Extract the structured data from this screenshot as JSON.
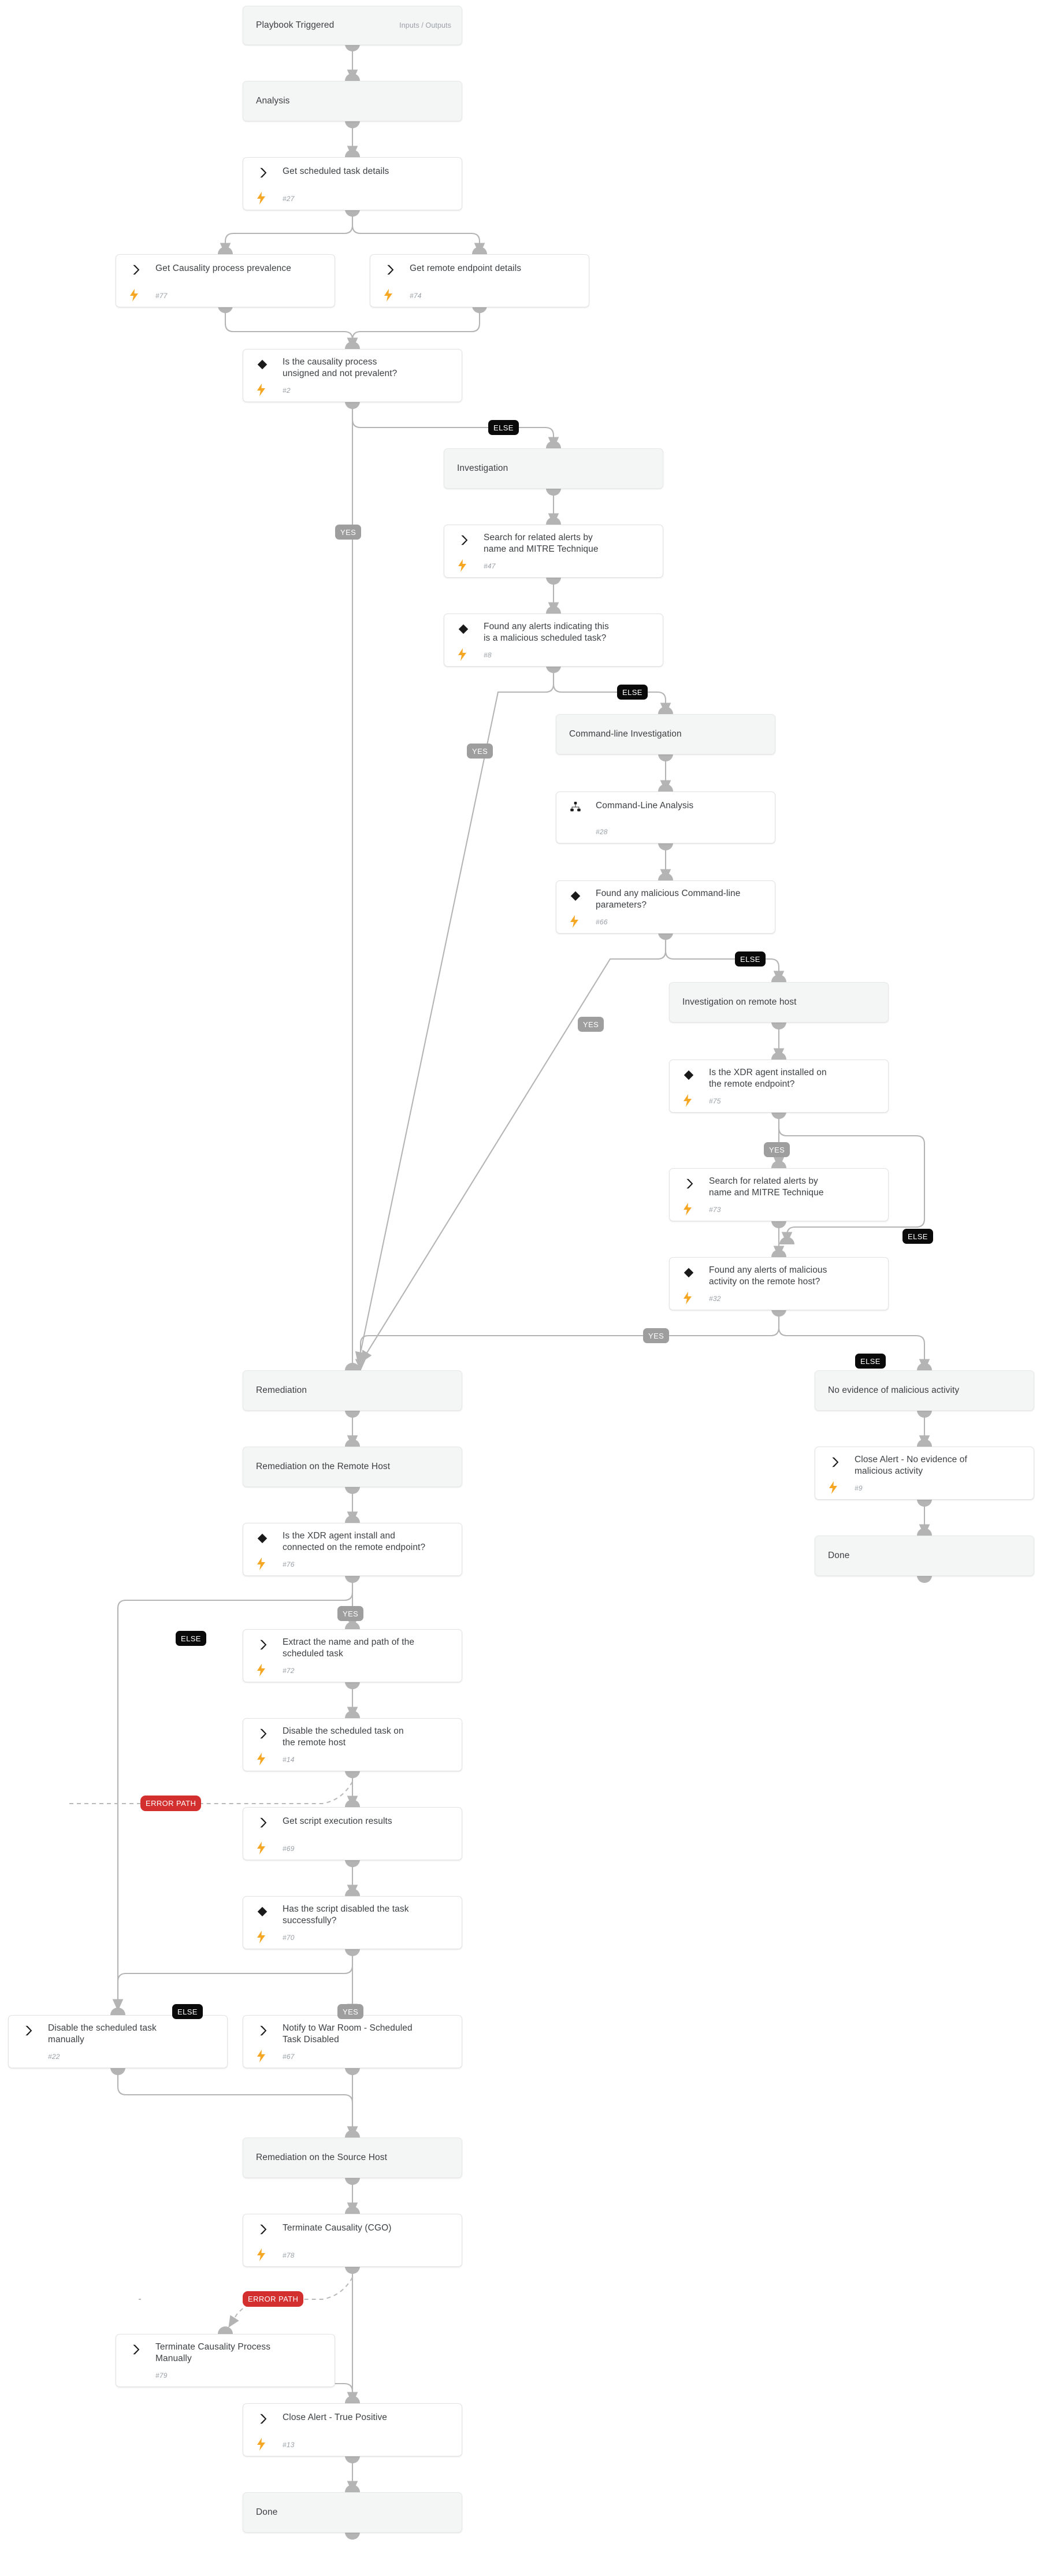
{
  "diagram": {
    "kind": "playbook-flowchart",
    "colors": {
      "wire": "#b4b4b4",
      "card_bg": "#ffffff",
      "section_bg": "#f4f6f5",
      "border": "#e2e2e2",
      "text": "#3c4043",
      "muted": "#9aa0a6",
      "bolt": "#f5a623",
      "yes_pill": "#9e9e9e",
      "else_pill": "#0a0a0a",
      "error_pill": "#d32f2f"
    },
    "icons": {
      "task": "chevron-right-icon",
      "conditional": "diamond-icon",
      "subplaybook": "sitemap-icon",
      "automation": "lightning-bolt-icon"
    }
  },
  "nodes": [
    {
      "id": "start",
      "type": "section",
      "title": "Playbook Triggered",
      "meta": "Inputs / Outputs"
    },
    {
      "id": "analysis",
      "type": "section",
      "title": "Analysis"
    },
    {
      "id": "t27",
      "type": "task",
      "title": "Get scheduled task details",
      "task_id": "#27",
      "automated": true
    },
    {
      "id": "t77",
      "type": "task",
      "title": "Get Causality process prevalence",
      "task_id": "#77",
      "automated": true
    },
    {
      "id": "t74",
      "type": "task",
      "title": "Get remote endpoint details",
      "task_id": "#74",
      "automated": true
    },
    {
      "id": "c2",
      "type": "conditional",
      "title": "Is the causality process\nunsigned and not prevalent?",
      "task_id": "#2",
      "automated": true
    },
    {
      "id": "sec_inv",
      "type": "section",
      "title": "Investigation"
    },
    {
      "id": "t47",
      "type": "task",
      "title": "Search for related alerts by\nname and MITRE Technique",
      "task_id": "#47",
      "automated": true
    },
    {
      "id": "c8",
      "type": "conditional",
      "title": "Found any alerts indicating this\nis a malicious scheduled task?",
      "task_id": "#8",
      "automated": true
    },
    {
      "id": "sec_cli",
      "type": "section",
      "title": "Command-line Investigation"
    },
    {
      "id": "t28",
      "type": "subplaybook",
      "title": "Command-Line Analysis",
      "task_id": "#28",
      "automated": false
    },
    {
      "id": "c66",
      "type": "conditional",
      "title": "Found any malicious Command-line\nparameters?",
      "task_id": "#66",
      "automated": true
    },
    {
      "id": "sec_rem_inv",
      "type": "section",
      "title": "Investigation on remote host"
    },
    {
      "id": "c75",
      "type": "conditional",
      "title": "Is the XDR agent installed on\nthe remote endpoint?",
      "task_id": "#75",
      "automated": true
    },
    {
      "id": "t73",
      "type": "task",
      "title": "Search for related alerts by\nname and MITRE Technique",
      "task_id": "#73",
      "automated": true
    },
    {
      "id": "c32",
      "type": "conditional",
      "title": "Found any alerts of malicious\nactivity on the remote host?",
      "task_id": "#32",
      "automated": true
    },
    {
      "id": "sec_remediation",
      "type": "section",
      "title": "Remediation"
    },
    {
      "id": "sec_rem_remote",
      "type": "section",
      "title": "Remediation on the Remote Host"
    },
    {
      "id": "c76",
      "type": "conditional",
      "title": "Is the XDR agent install and\nconnected on the remote endpoint?",
      "task_id": "#76",
      "automated": true
    },
    {
      "id": "t72",
      "type": "task",
      "title": "Extract the name and path of the\nscheduled task",
      "task_id": "#72",
      "automated": true
    },
    {
      "id": "t14",
      "type": "task",
      "title": "Disable the scheduled task on\nthe remote host",
      "task_id": "#14",
      "automated": true
    },
    {
      "id": "t69",
      "type": "task",
      "title": "Get script execution results",
      "task_id": "#69",
      "automated": true
    },
    {
      "id": "c70",
      "type": "conditional",
      "title": "Has the script disabled the task\nsuccessfully?",
      "task_id": "#70",
      "automated": true
    },
    {
      "id": "t22",
      "type": "task",
      "title": "Disable the scheduled task\nmanually",
      "task_id": "#22",
      "automated": false
    },
    {
      "id": "t67",
      "type": "task",
      "title": "Notify to War Room - Scheduled\nTask Disabled",
      "task_id": "#67",
      "automated": true
    },
    {
      "id": "sec_rem_source",
      "type": "section",
      "title": "Remediation on the Source Host"
    },
    {
      "id": "t78",
      "type": "task",
      "title": "Terminate Causality (CGO)",
      "task_id": "#78",
      "automated": true
    },
    {
      "id": "t79",
      "type": "task",
      "title": "Terminate Causality Process\nManually",
      "task_id": "#79",
      "automated": false
    },
    {
      "id": "t13",
      "type": "task",
      "title": "Close Alert - True Positive",
      "task_id": "#13",
      "automated": true
    },
    {
      "id": "done_left",
      "type": "section",
      "title": "Done"
    },
    {
      "id": "sec_noevid",
      "type": "section",
      "title": "No evidence of malicious activity"
    },
    {
      "id": "t9",
      "type": "task",
      "title": "Close Alert - No evidence of\nmalicious activity",
      "task_id": "#9",
      "automated": true
    },
    {
      "id": "done_right",
      "type": "section",
      "title": "Done"
    }
  ],
  "branch_labels": [
    {
      "id": "yes_c2",
      "text": "YES"
    },
    {
      "id": "else_c2",
      "text": "ELSE"
    },
    {
      "id": "yes_c8",
      "text": "YES"
    },
    {
      "id": "else_c8",
      "text": "ELSE"
    },
    {
      "id": "yes_c66",
      "text": "YES"
    },
    {
      "id": "else_c66",
      "text": "ELSE"
    },
    {
      "id": "yes_c75",
      "text": "YES"
    },
    {
      "id": "else_c75",
      "text": "ELSE"
    },
    {
      "id": "yes_c32",
      "text": "YES"
    },
    {
      "id": "else_c32",
      "text": "ELSE"
    },
    {
      "id": "yes_c76",
      "text": "YES"
    },
    {
      "id": "else_c76",
      "text": "ELSE"
    },
    {
      "id": "yes_c70",
      "text": "YES"
    },
    {
      "id": "else_c70",
      "text": "ELSE"
    },
    {
      "id": "err_t14",
      "text": "ERROR PATH"
    },
    {
      "id": "err_t78",
      "text": "ERROR PATH"
    }
  ]
}
